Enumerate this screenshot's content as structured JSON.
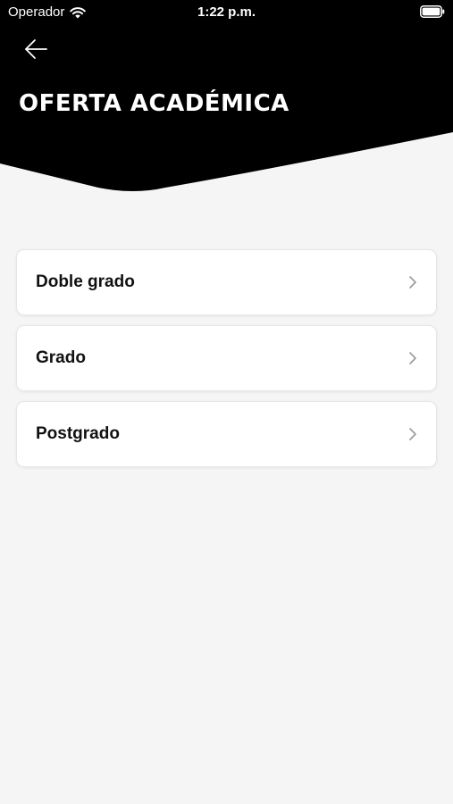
{
  "status_bar": {
    "carrier": "Operador",
    "time": "1:22 p.m.",
    "wifi_icon": "wifi-icon",
    "battery_icon": "battery-icon"
  },
  "header": {
    "back_icon": "arrow-left-icon",
    "title": "OFERTA ACADÉMICA",
    "background_color": "#000000",
    "text_color": "#ffffff"
  },
  "menu": {
    "items": [
      {
        "label": "Doble grado",
        "icon": "chevron-right-icon"
      },
      {
        "label": "Grado",
        "icon": "chevron-right-icon"
      },
      {
        "label": "Postgrado",
        "icon": "chevron-right-icon"
      }
    ]
  },
  "colors": {
    "page_background": "#f5f5f5",
    "card_background": "#ffffff",
    "chevron": "#9a9a9a"
  }
}
